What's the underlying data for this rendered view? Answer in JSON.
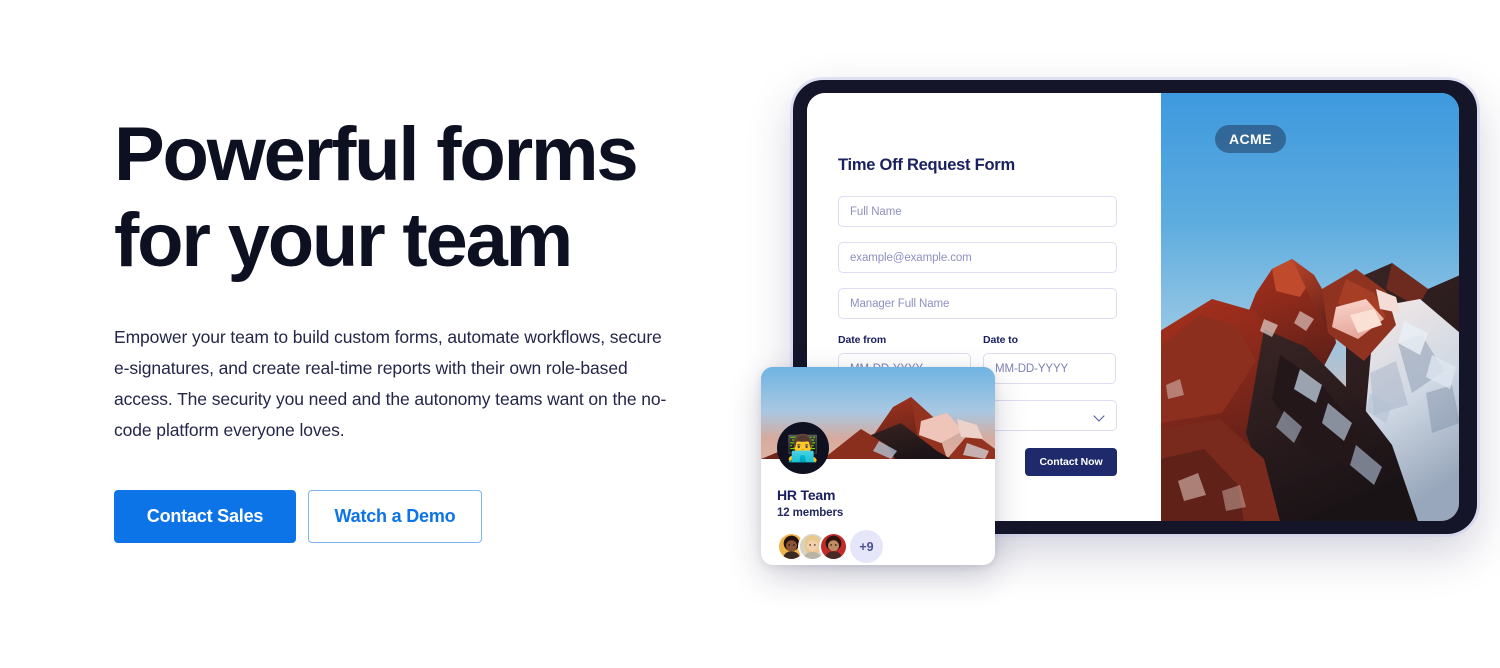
{
  "hero": {
    "title": "Powerful forms\nfor your team",
    "subtitle": "Empower your team to build custom forms, automate workflows, secure e-signatures, and create real-time reports with their own role-based access. The security you need and the autonomy teams want on the no-code platform everyone loves.",
    "primary_cta": "Contact Sales",
    "secondary_cta": "Watch a Demo",
    "title_color": "#0d1021",
    "primary_color": "#0d74e7"
  },
  "device": {
    "type": "tablet",
    "frame_color": "#141529"
  },
  "form": {
    "title": "Time Off Request Form",
    "fields": [
      {
        "name": "full-name",
        "placeholder": "Full Name"
      },
      {
        "name": "email",
        "placeholder": "example@example.com"
      },
      {
        "name": "manager-full-name",
        "placeholder": "Manager Full Name"
      }
    ],
    "date_from": {
      "label": "Date from",
      "placeholder": "MM-DD-YYYY"
    },
    "date_to": {
      "label": "Date to",
      "placeholder": "MM-DD-YYYY"
    },
    "select": {
      "value": "",
      "icon": "chevron-down-icon"
    },
    "submit_label": "Contact Now",
    "submit_color": "#1e2a6b"
  },
  "photo": {
    "badge": "ACME",
    "subject": "mountain-peak-at-sunset"
  },
  "team_card": {
    "avatar_icon": "person-on-laptop-emoji",
    "name": "HR Team",
    "members": "12 members",
    "overflow_badge": "+9",
    "avatar_count": 3
  }
}
